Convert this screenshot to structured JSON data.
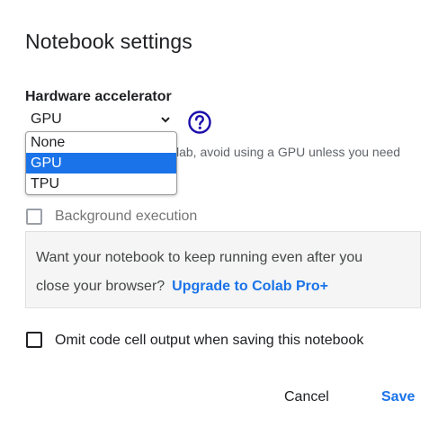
{
  "dialog": {
    "title": "Notebook settings"
  },
  "hardware": {
    "label": "Hardware accelerator",
    "selected": "GPU",
    "hint": "lab, avoid using a GPU unless you need",
    "options": [
      "None",
      "GPU",
      "TPU"
    ],
    "help_icon": "help-circle-icon"
  },
  "background_execution": {
    "label": "Background execution",
    "checked": false,
    "disabled": true
  },
  "info_box": {
    "text_line1": "Want your notebook to keep running even after you",
    "text_line2": "close your browser?",
    "link_label": "Upgrade to Colab Pro+"
  },
  "omit_output": {
    "label": "Omit code cell output when saving this notebook",
    "checked": false
  },
  "actions": {
    "cancel_label": "Cancel",
    "save_label": "Save"
  },
  "colors": {
    "accent": "#1a73e8",
    "help_icon": "#1a0dab",
    "info_box_bg": "#f5f5f5"
  }
}
